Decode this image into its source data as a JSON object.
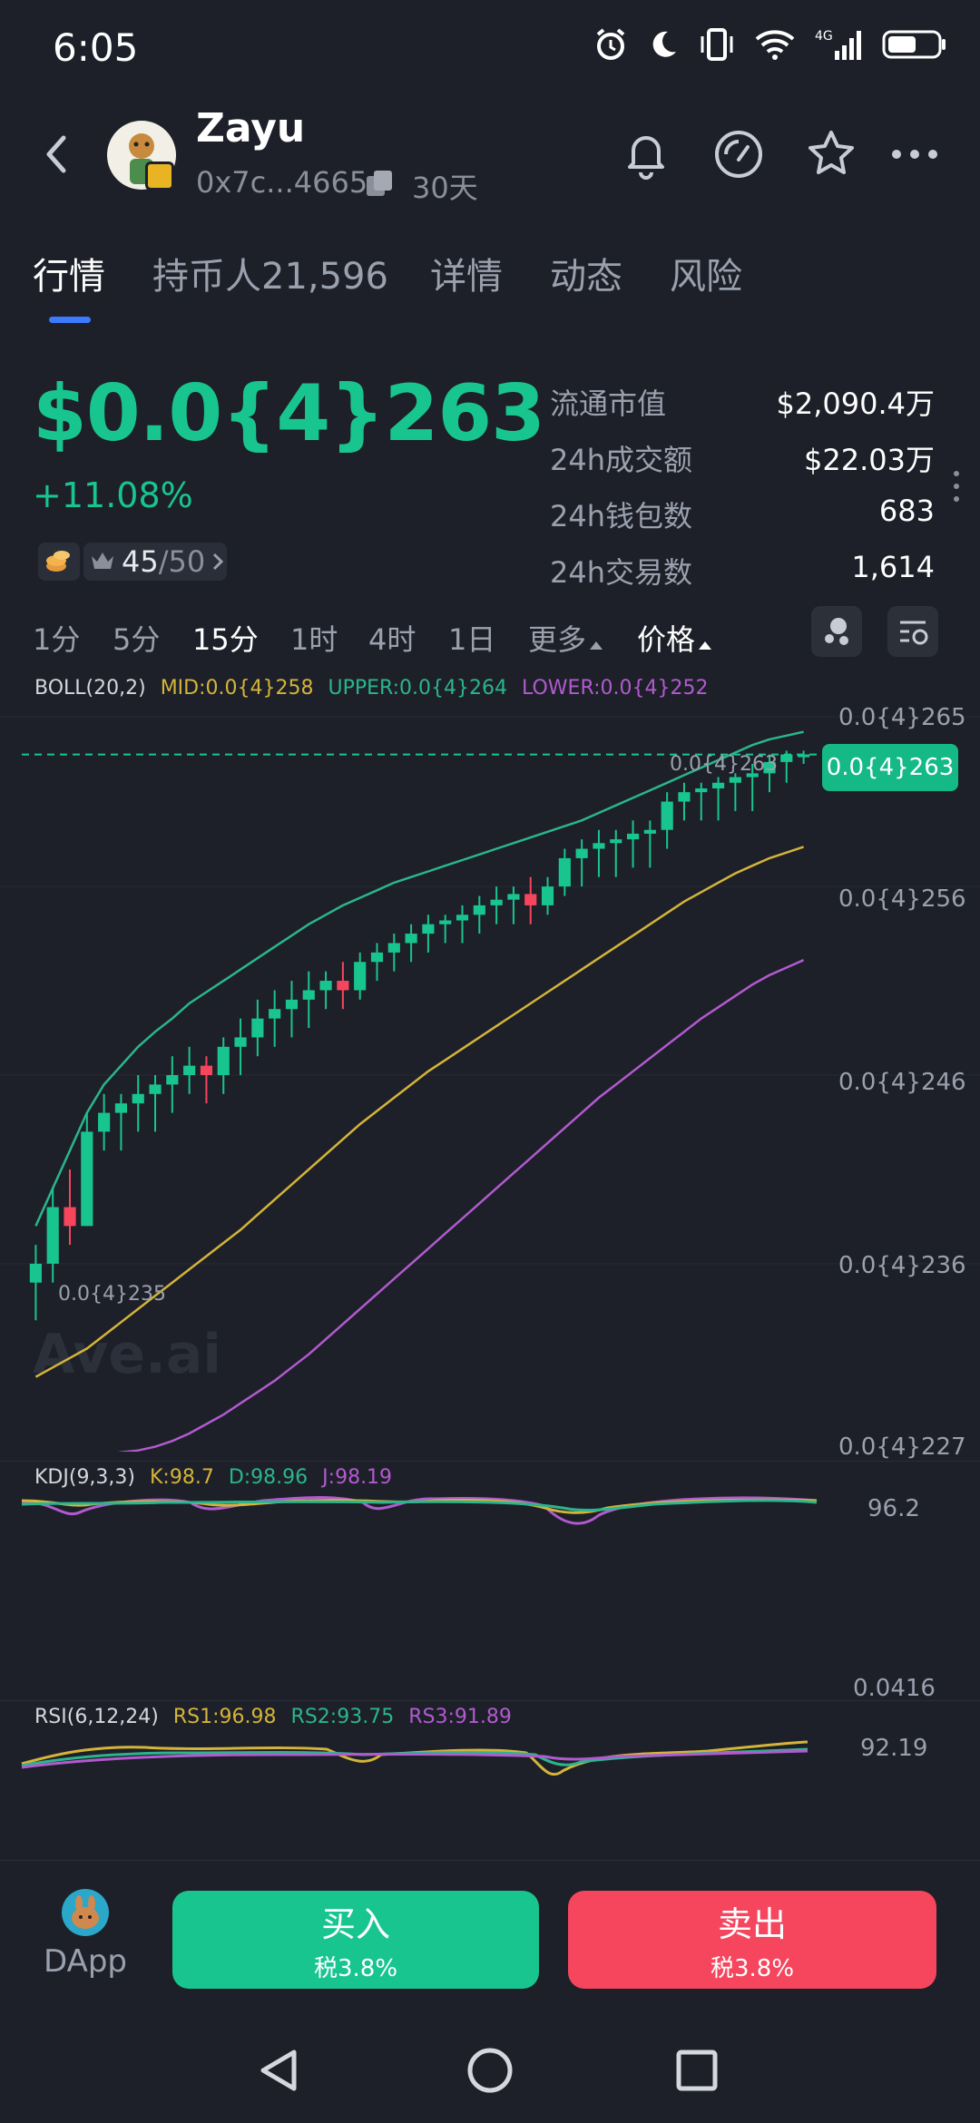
{
  "status_bar": {
    "time": "6:05",
    "icons": [
      "alarm-icon",
      "moon-icon",
      "vibrate-icon",
      "wifi-icon",
      "4g-signal-icon",
      "battery-icon"
    ]
  },
  "header": {
    "token_name": "Zayu",
    "address": "0x7c...4665",
    "period": "30天",
    "icons": [
      "back-icon",
      "bell-icon",
      "gauge-icon",
      "star-icon",
      "more-icon"
    ]
  },
  "tabs": [
    {
      "label": "行情",
      "active": true
    },
    {
      "label": "持币人21,596",
      "active": false
    },
    {
      "label": "详情",
      "active": false
    },
    {
      "label": "动态",
      "active": false
    },
    {
      "label": "风险",
      "active": false
    }
  ],
  "price": {
    "value": "$0.0{4}263",
    "change": "+11.08%",
    "rank": "45",
    "rank_total": "/50"
  },
  "stats": [
    {
      "label": "流通市值",
      "value": "$2,090.4万"
    },
    {
      "label": "24h成交额",
      "value": "$22.03万"
    },
    {
      "label": "24h钱包数",
      "value": "683"
    },
    {
      "label": "24h交易数",
      "value": "1,614"
    }
  ],
  "timeframes": [
    {
      "label": "1分",
      "active": false
    },
    {
      "label": "5分",
      "active": false
    },
    {
      "label": "15分",
      "active": true
    },
    {
      "label": "1时",
      "active": false
    },
    {
      "label": "4时",
      "active": false
    },
    {
      "label": "1日",
      "active": false
    },
    {
      "label": "更多",
      "active": false,
      "dropdown": true
    },
    {
      "label": "价格",
      "active": true,
      "dropdown": true
    }
  ],
  "chart": {
    "boll": {
      "name": "BOLL(20,2)",
      "mid": "MID:0.0{4}258",
      "upper": "UPPER:0.0{4}264",
      "lower": "LOWER:0.0{4}252",
      "colors": {
        "mid": "#d4b43a",
        "upper": "#2bb58d",
        "lower": "#b25ad0"
      }
    },
    "y_axis_labels": [
      "0.0{4}265",
      "0.0{4}256",
      "0.0{4}246",
      "0.0{4}236",
      "0.0{4}227"
    ],
    "current_price_tag": "0.0{4}263",
    "high_label": "0.0{4}263",
    "low_label": "0.0{4}235",
    "watermark": "Ave.ai",
    "kdj": {
      "name": "KDJ(9,3,3)",
      "k": "K:98.7",
      "d": "D:98.96",
      "j": "J:98.19",
      "axis_top": "96.2",
      "axis_bottom": "0.0416"
    },
    "rsi": {
      "name": "RSI(6,12,24)",
      "rs1": "RS1:96.98",
      "rs2": "RS2:93.75",
      "rs3": "RS3:91.89",
      "axis": "92.19"
    },
    "colors": {
      "up": "#19c58f",
      "down": "#f5465e"
    }
  },
  "chart_data": {
    "type": "candlestick",
    "y_unit": "0.0{4}x (×1e-4... subscript notation)",
    "ylim": [
      227,
      265
    ],
    "candles": [
      {
        "o": 235,
        "h": 237,
        "l": 233,
        "c": 236
      },
      {
        "o": 236,
        "h": 240,
        "l": 235,
        "c": 239
      },
      {
        "o": 239,
        "h": 241,
        "l": 237,
        "c": 238
      },
      {
        "o": 238,
        "h": 244,
        "l": 238,
        "c": 243
      },
      {
        "o": 243,
        "h": 245,
        "l": 242,
        "c": 244
      },
      {
        "o": 244,
        "h": 245,
        "l": 242,
        "c": 244.5
      },
      {
        "o": 244.5,
        "h": 246,
        "l": 243,
        "c": 245
      },
      {
        "o": 245,
        "h": 246,
        "l": 243,
        "c": 245.5
      },
      {
        "o": 245.5,
        "h": 247,
        "l": 244,
        "c": 246
      },
      {
        "o": 246,
        "h": 247.5,
        "l": 245,
        "c": 246.5
      },
      {
        "o": 246.5,
        "h": 247,
        "l": 244.5,
        "c": 246
      },
      {
        "o": 246,
        "h": 248,
        "l": 245,
        "c": 247.5
      },
      {
        "o": 247.5,
        "h": 249,
        "l": 246,
        "c": 248
      },
      {
        "o": 248,
        "h": 250,
        "l": 247,
        "c": 249
      },
      {
        "o": 249,
        "h": 250.5,
        "l": 247.5,
        "c": 249.5
      },
      {
        "o": 249.5,
        "h": 251,
        "l": 248,
        "c": 250
      },
      {
        "o": 250,
        "h": 251.5,
        "l": 248.5,
        "c": 250.5
      },
      {
        "o": 250.5,
        "h": 251.5,
        "l": 249.5,
        "c": 251
      },
      {
        "o": 251,
        "h": 252,
        "l": 249.5,
        "c": 250.5
      },
      {
        "o": 250.5,
        "h": 252.5,
        "l": 250,
        "c": 252
      },
      {
        "o": 252,
        "h": 253,
        "l": 251,
        "c": 252.5
      },
      {
        "o": 252.5,
        "h": 253.5,
        "l": 251.5,
        "c": 253
      },
      {
        "o": 253,
        "h": 254,
        "l": 252,
        "c": 253.5
      },
      {
        "o": 253.5,
        "h": 254.5,
        "l": 252.5,
        "c": 254
      },
      {
        "o": 254,
        "h": 254.5,
        "l": 253,
        "c": 254.2
      },
      {
        "o": 254.2,
        "h": 255,
        "l": 253,
        "c": 254.5
      },
      {
        "o": 254.5,
        "h": 255.5,
        "l": 253.5,
        "c": 255
      },
      {
        "o": 255,
        "h": 256,
        "l": 254,
        "c": 255.3
      },
      {
        "o": 255.3,
        "h": 256,
        "l": 254,
        "c": 255.6
      },
      {
        "o": 255.6,
        "h": 256.5,
        "l": 254,
        "c": 255
      },
      {
        "o": 255,
        "h": 256.5,
        "l": 254.5,
        "c": 256
      },
      {
        "o": 256,
        "h": 258,
        "l": 255.5,
        "c": 257.5
      },
      {
        "o": 257.5,
        "h": 258.5,
        "l": 256,
        "c": 258
      },
      {
        "o": 258,
        "h": 259,
        "l": 256.5,
        "c": 258.3
      },
      {
        "o": 258.3,
        "h": 259,
        "l": 256.5,
        "c": 258.5
      },
      {
        "o": 258.5,
        "h": 259.5,
        "l": 257,
        "c": 258.8
      },
      {
        "o": 258.8,
        "h": 259.5,
        "l": 257,
        "c": 259
      },
      {
        "o": 259,
        "h": 261,
        "l": 258,
        "c": 260.5
      },
      {
        "o": 260.5,
        "h": 261.5,
        "l": 259.5,
        "c": 261
      },
      {
        "o": 261,
        "h": 261.5,
        "l": 259.5,
        "c": 261.2
      },
      {
        "o": 261.2,
        "h": 261.8,
        "l": 259.5,
        "c": 261.5
      },
      {
        "o": 261.5,
        "h": 262,
        "l": 260,
        "c": 261.8
      },
      {
        "o": 261.8,
        "h": 262.5,
        "l": 260,
        "c": 262
      },
      {
        "o": 262,
        "h": 263,
        "l": 261,
        "c": 262.6
      },
      {
        "o": 262.6,
        "h": 263.2,
        "l": 261.5,
        "c": 263
      },
      {
        "o": 263,
        "h": 263.2,
        "l": 262.5,
        "c": 263
      }
    ],
    "series": [
      {
        "name": "UPPER",
        "values": [
          238,
          240,
          242,
          244,
          245.5,
          246.5,
          247.5,
          248.3,
          249,
          249.8,
          250.4,
          251,
          251.6,
          252.2,
          252.8,
          253.4,
          254,
          254.5,
          255,
          255.4,
          255.8,
          256.2,
          256.5,
          256.8,
          257.1,
          257.4,
          257.7,
          258,
          258.3,
          258.6,
          258.9,
          259.2,
          259.5,
          259.9,
          260.3,
          260.7,
          261.1,
          261.5,
          261.9,
          262.3,
          262.7,
          263.1,
          263.5,
          263.8,
          264,
          264.2
        ]
      },
      {
        "name": "MID",
        "values": [
          230,
          230.5,
          231,
          231.5,
          232.2,
          232.9,
          233.6,
          234.3,
          235,
          235.7,
          236.4,
          237.1,
          237.8,
          238.6,
          239.4,
          240.2,
          241,
          241.8,
          242.6,
          243.4,
          244.1,
          244.8,
          245.5,
          246.2,
          246.8,
          247.4,
          248,
          248.6,
          249.2,
          249.8,
          250.4,
          251,
          251.6,
          252.2,
          252.8,
          253.4,
          254,
          254.6,
          255.2,
          255.7,
          256.2,
          256.7,
          257.1,
          257.5,
          257.8,
          258.1
        ]
      },
      {
        "name": "LOWER",
        "values": [
          225.5,
          225.6,
          225.7,
          225.8,
          225.9,
          226,
          226.1,
          226.3,
          226.6,
          227,
          227.5,
          228,
          228.6,
          229.2,
          229.8,
          230.5,
          231.2,
          232,
          232.8,
          233.6,
          234.4,
          235.2,
          236,
          236.8,
          237.6,
          238.4,
          239.2,
          240,
          240.8,
          241.6,
          242.4,
          243.2,
          244,
          244.8,
          245.5,
          246.2,
          246.9,
          247.6,
          248.3,
          249,
          249.6,
          250.2,
          250.8,
          251.3,
          251.7,
          252.1
        ]
      }
    ]
  },
  "bottom": {
    "dapp_label": "DApp",
    "buy_label": "买入",
    "buy_tax": "税3.8%",
    "sell_label": "卖出",
    "sell_tax": "税3.8%"
  }
}
